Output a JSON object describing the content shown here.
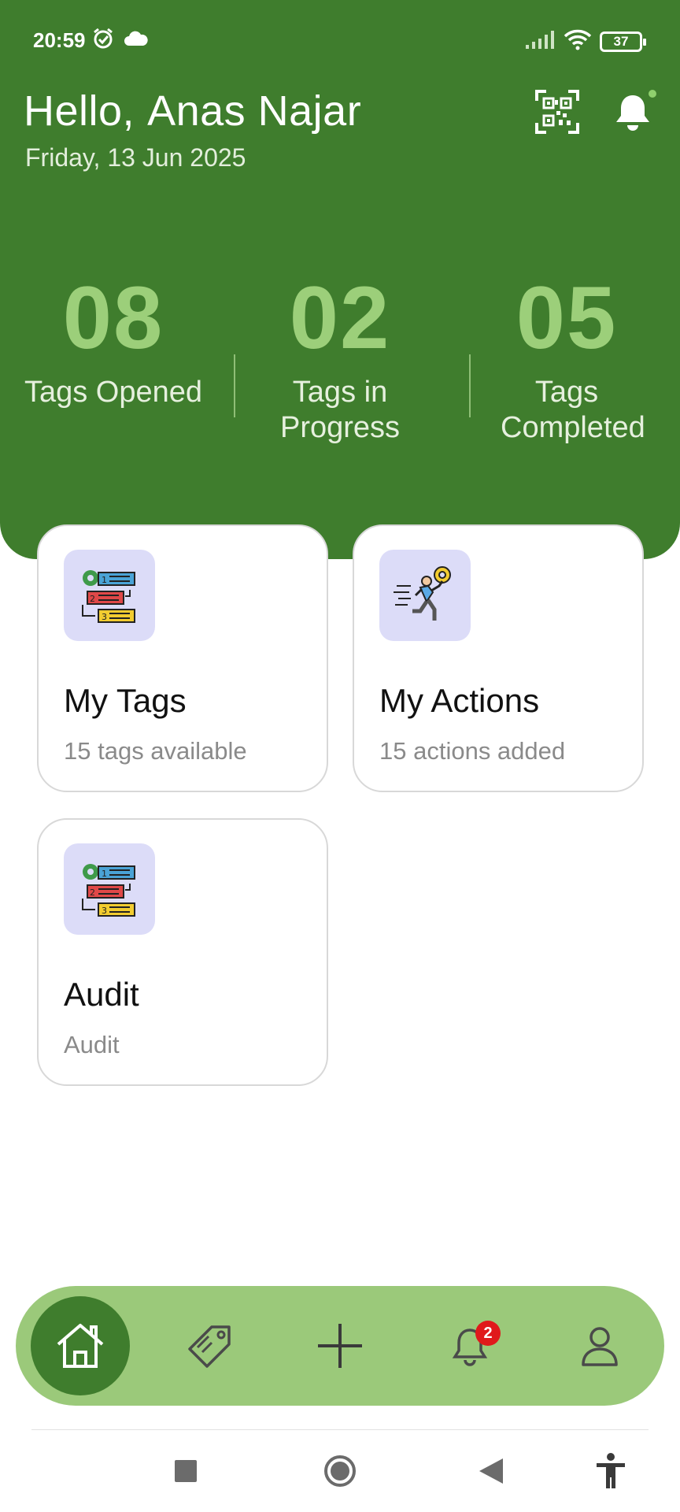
{
  "status_bar": {
    "time": "20:59",
    "battery": "37",
    "icons": [
      "alarm-icon",
      "cloud-icon",
      "signal-icon",
      "wifi-icon",
      "battery-icon"
    ]
  },
  "header": {
    "greeting_prefix": "Hello,",
    "user_name": "Anas Najar",
    "date": "Friday, 13 Jun 2025",
    "actions": [
      "qr-code-icon",
      "bell-icon"
    ]
  },
  "stats": [
    {
      "value": "08",
      "label": "Tags Opened"
    },
    {
      "value": "02",
      "label": "Tags in Progress"
    },
    {
      "value": "05",
      "label": "Tags Completed"
    }
  ],
  "cards": {
    "my_tags": {
      "title": "My Tags",
      "subtitle": "15 tags available",
      "icon": "workflow-steps-icon"
    },
    "my_actions": {
      "title": "My Actions",
      "subtitle": "15 actions added",
      "icon": "running-person-gear-icon"
    },
    "audit": {
      "title": "Audit",
      "subtitle": "Audit",
      "icon": "workflow-steps-icon"
    }
  },
  "bottom_nav": {
    "items": [
      "home-icon",
      "tag-icon",
      "plus-icon",
      "bell-icon",
      "user-icon"
    ],
    "active": "home-icon",
    "notification_badge": "2"
  },
  "colors": {
    "primary_green": "#3f7d2d",
    "light_green": "#9bc97a",
    "stat_number_green": "#9ccf7a",
    "card_icon_bg": "#dcdcf8",
    "badge_red": "#e0191b"
  }
}
